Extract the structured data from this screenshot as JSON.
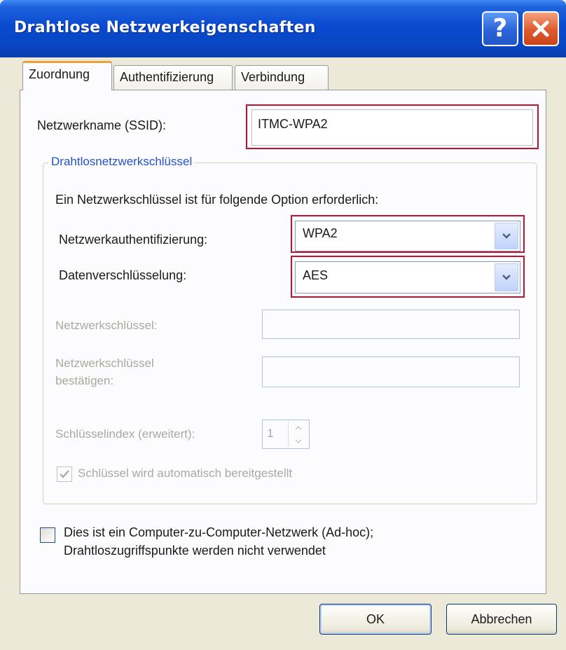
{
  "window": {
    "title": "Drahtlose Netzwerkeigenschaften"
  },
  "titlebar": {
    "help_label": "?",
    "help_icon": "help-icon",
    "close_icon": "close-icon"
  },
  "tabs": [
    {
      "label": "Zuordnung",
      "active": true
    },
    {
      "label": "Authentifizierung",
      "active": false
    },
    {
      "label": "Verbindung",
      "active": false
    }
  ],
  "ssid": {
    "label": "Netzwerkname (SSID):",
    "value": "ITMC-WPA2"
  },
  "key_group": {
    "legend": "Drahtlosnetzwerkschlüssel",
    "intro": "Ein Netzwerkschlüssel ist für folgende Option erforderlich:",
    "auth": {
      "label": "Netzwerkauthentifizierung:",
      "value": "WPA2"
    },
    "encryption": {
      "label": "Datenverschlüsselung:",
      "value": "AES"
    },
    "network_key": {
      "label": "Netzwerkschlüssel:",
      "value": ""
    },
    "confirm_key": {
      "label_line1": "Netzwerkschlüssel",
      "label_line2": "bestätigen:",
      "value": ""
    },
    "key_index": {
      "label": "Schlüsselindex (erweitert):",
      "value": "1"
    },
    "auto_key": {
      "label": "Schlüssel wird automatisch bereitgestellt",
      "checked": true
    }
  },
  "adhoc": {
    "line1": "Dies ist ein Computer-zu-Computer-Netzwerk (Ad-hoc);",
    "line2": "Drahtloszugriffspunkte werden nicht verwendet",
    "checked": false
  },
  "buttons": {
    "ok": "OK",
    "cancel": "Abbrechen"
  },
  "colors": {
    "highlight": "#c8102e",
    "titlebar": "#0a4ad0",
    "group_legend": "#2552c7"
  }
}
